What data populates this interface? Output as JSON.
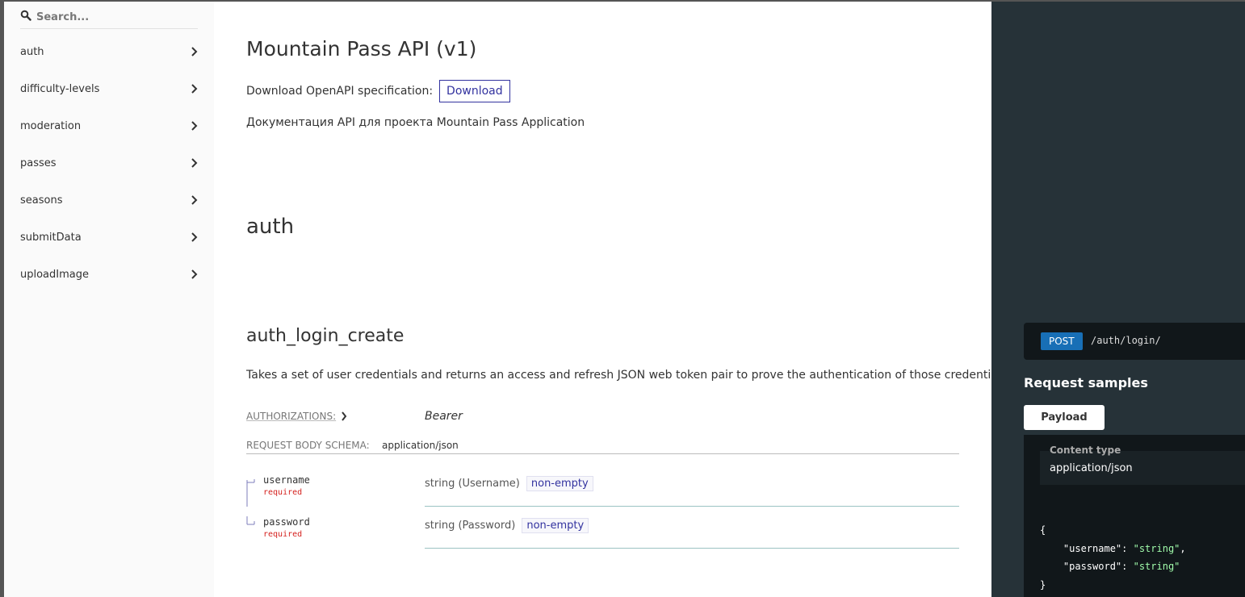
{
  "sidebar": {
    "search_placeholder": "Search...",
    "items": [
      {
        "label": "auth"
      },
      {
        "label": "difficulty-levels"
      },
      {
        "label": "moderation"
      },
      {
        "label": "passes"
      },
      {
        "label": "seasons"
      },
      {
        "label": "submitData"
      },
      {
        "label": "uploadImage"
      }
    ]
  },
  "main": {
    "title": "Mountain Pass API (v1)",
    "download_text": "Download OpenAPI specification:",
    "download_button": "Download",
    "description": "Документация API для проекта Mountain Pass Application",
    "section_title": "auth",
    "operation": {
      "title": "auth_login_create",
      "description": "Takes a set of user credentials and returns an access and refresh JSON web token pair to prove the authentication of those credentials.",
      "authorizations_label": "AUTHORIZATIONS:",
      "authorizations_value": "Bearer",
      "schema_label": "REQUEST BODY SCHEMA:",
      "schema_value": "application/json",
      "params": [
        {
          "name": "username",
          "required": "required",
          "type": "string (Username)",
          "constraint": "non-empty"
        },
        {
          "name": "password",
          "required": "required",
          "type": "string (Password)",
          "constraint": "non-empty"
        }
      ]
    }
  },
  "right": {
    "method": "POST",
    "path": "/auth/login/",
    "samples_title": "Request samples",
    "tab_label": "Payload",
    "content_type_label": "Content type",
    "content_type_value": "application/json",
    "code": {
      "open": "{",
      "line1_key": "\"username\"",
      "line1_val": "\"string\"",
      "line2_key": "\"password\"",
      "line2_val": "\"string\"",
      "close": "}"
    }
  },
  "colors": {
    "accent": "#32329f",
    "post_badge": "#186fb6",
    "right_panel": "#263238",
    "required": "#d41f1c"
  }
}
